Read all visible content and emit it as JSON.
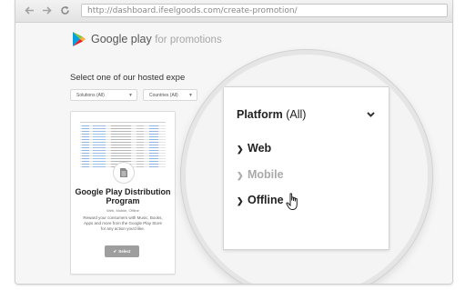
{
  "browser": {
    "url": "http://dashboard.ifeelgoods.com/create-promotion/",
    "back_icon": "back-arrow-icon",
    "forward_icon": "forward-arrow-icon",
    "reload_icon": "reload-icon"
  },
  "brand": {
    "name": "Google play",
    "tagline": "for promotions"
  },
  "main": {
    "heading": "Select one of our hosted expe",
    "filters": [
      {
        "label": "Solutions (All)"
      },
      {
        "label": "Countries (All)"
      }
    ]
  },
  "card": {
    "title": "Google Play Distribution Program",
    "platforms": "Web, Mobile, Offline",
    "description": "Reward your consumers with Music, Books, Apps and more from the Google Play Store for any action you'd like.",
    "select_label": "Select",
    "check_icon": "check-icon",
    "doc_icon": "document-icon"
  },
  "dropdown": {
    "header_label": "Platform",
    "header_value": "(All)",
    "items": [
      {
        "label": "Web"
      },
      {
        "label": "Mobile"
      },
      {
        "label": "Offline"
      }
    ]
  },
  "colors": {
    "google_play_blue": "#00a0e3",
    "google_play_green": "#8ac43f",
    "google_play_yellow": "#fbb03b",
    "google_play_red": "#ed1c24"
  }
}
